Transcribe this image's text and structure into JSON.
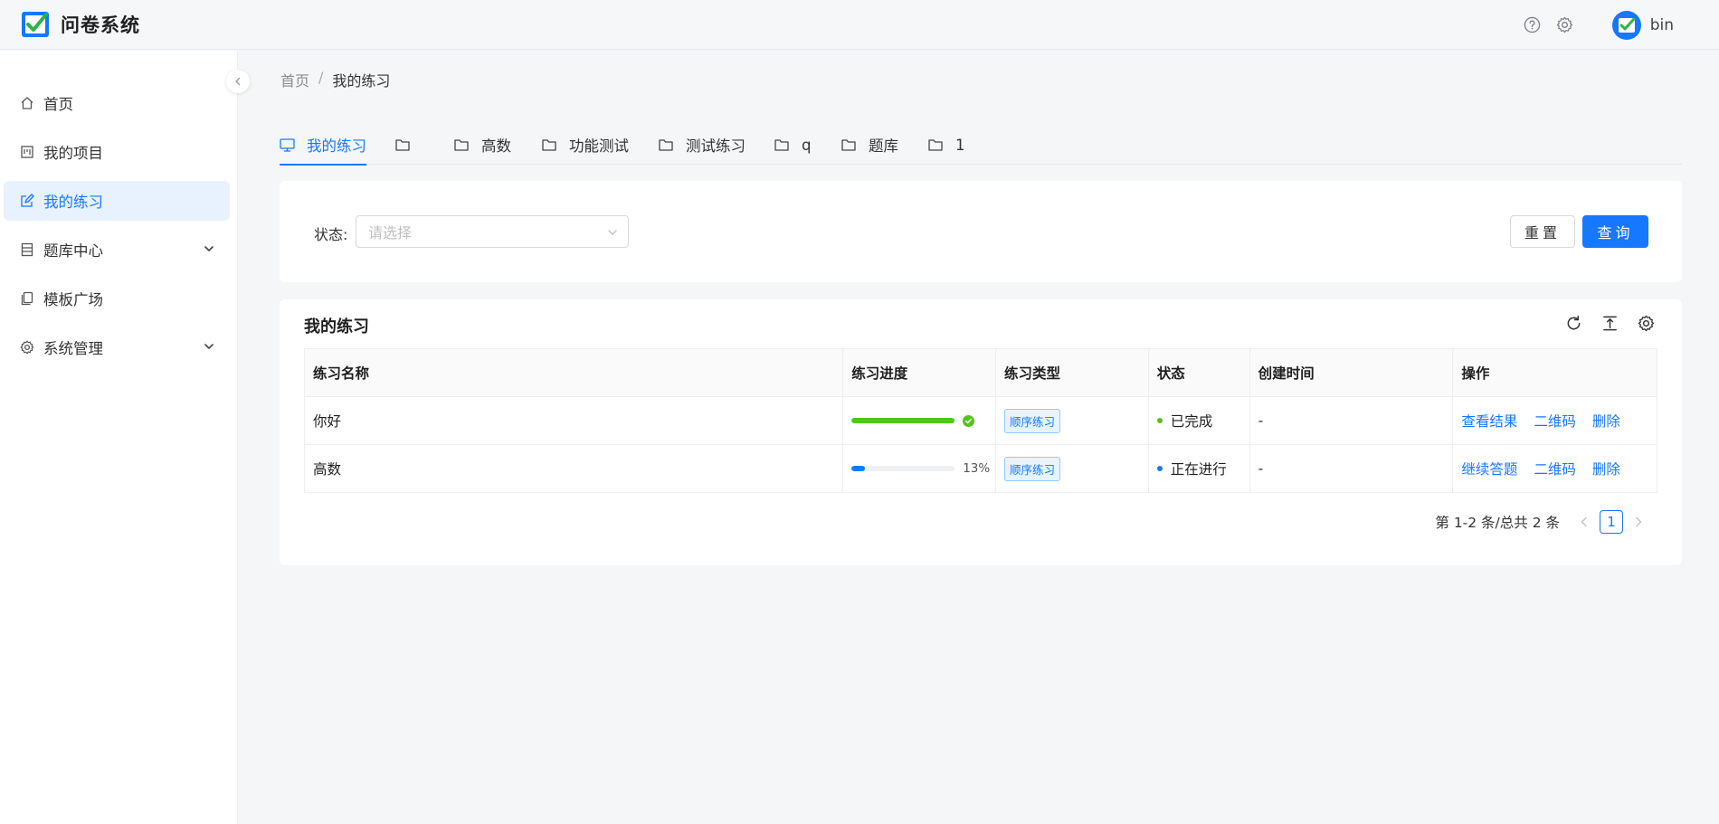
{
  "app": {
    "title": "问卷系统"
  },
  "header": {
    "username": "bin"
  },
  "sidebar": {
    "items": [
      {
        "label": "首页",
        "icon": "home-icon"
      },
      {
        "label": "我的项目",
        "icon": "project-icon"
      },
      {
        "label": "我的练习",
        "icon": "edit-icon",
        "active": true
      },
      {
        "label": "题库中心",
        "icon": "database-icon",
        "expandable": true
      },
      {
        "label": "模板广场",
        "icon": "copy-icon"
      },
      {
        "label": "系统管理",
        "icon": "gear-icon",
        "expandable": true
      }
    ]
  },
  "breadcrumb": {
    "home": "首页",
    "sep": "/",
    "current": "我的练习"
  },
  "tabs": [
    {
      "label": "我的练习",
      "icon": "monitor-icon",
      "active": true
    },
    {
      "label": "",
      "icon": "folder-icon"
    },
    {
      "label": "高数",
      "icon": "folder-icon"
    },
    {
      "label": "功能测试",
      "icon": "folder-icon"
    },
    {
      "label": "测试练习",
      "icon": "folder-icon"
    },
    {
      "label": "q",
      "icon": "folder-icon"
    },
    {
      "label": "题库",
      "icon": "folder-icon"
    },
    {
      "label": "1",
      "icon": "folder-icon"
    }
  ],
  "filter": {
    "status_label": "状态:",
    "status_placeholder": "请选择",
    "reset_label": "重置",
    "query_label": "查询"
  },
  "table": {
    "title": "我的练习",
    "columns": [
      "练习名称",
      "练习进度",
      "练习类型",
      "状态",
      "创建时间",
      "操作"
    ],
    "rows": [
      {
        "name": "你好",
        "progress": 100,
        "progress_text": "",
        "type": "顺序练习",
        "status": "已完成",
        "created": "-",
        "actions": [
          "查看结果",
          "二维码",
          "删除"
        ]
      },
      {
        "name": "高数",
        "progress": 13,
        "progress_text": "13%",
        "type": "顺序练习",
        "status": "正在进行",
        "created": "-",
        "actions": [
          "继续答题",
          "二维码",
          "删除"
        ]
      }
    ]
  },
  "pagination": {
    "total_text": "第 1-2 条/总共 2 条",
    "current": "1"
  },
  "colors": {
    "primary": "#1677ff",
    "success": "#52c41a"
  }
}
